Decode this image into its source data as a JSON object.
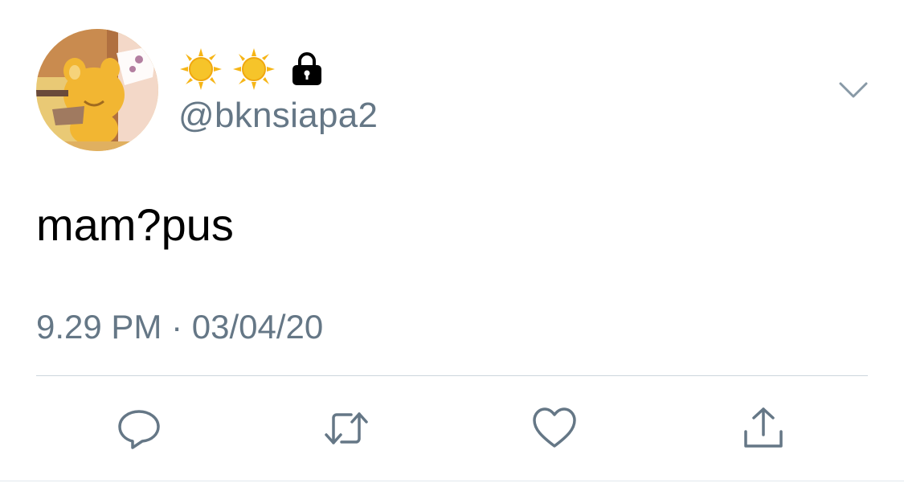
{
  "author": {
    "display_name_emojis": [
      "sun-emoji",
      "sun-emoji"
    ],
    "protected_icon": "lock-icon",
    "handle": "@bknsiapa2",
    "avatar_icon": "cartoon-character-avatar"
  },
  "tweet": {
    "text": "mam?pus",
    "timestamp": "9.29 PM · 03/04/20"
  },
  "menu_icon": "chevron-down-icon",
  "actions": [
    {
      "name": "reply",
      "icon": "reply-icon"
    },
    {
      "name": "retweet",
      "icon": "retweet-icon"
    },
    {
      "name": "like",
      "icon": "heart-icon"
    },
    {
      "name": "share",
      "icon": "share-icon"
    }
  ],
  "colors": {
    "secondary_text": "#657786",
    "primary_text": "#000000",
    "divider": "#ccd6dd",
    "icon": "#657786"
  }
}
